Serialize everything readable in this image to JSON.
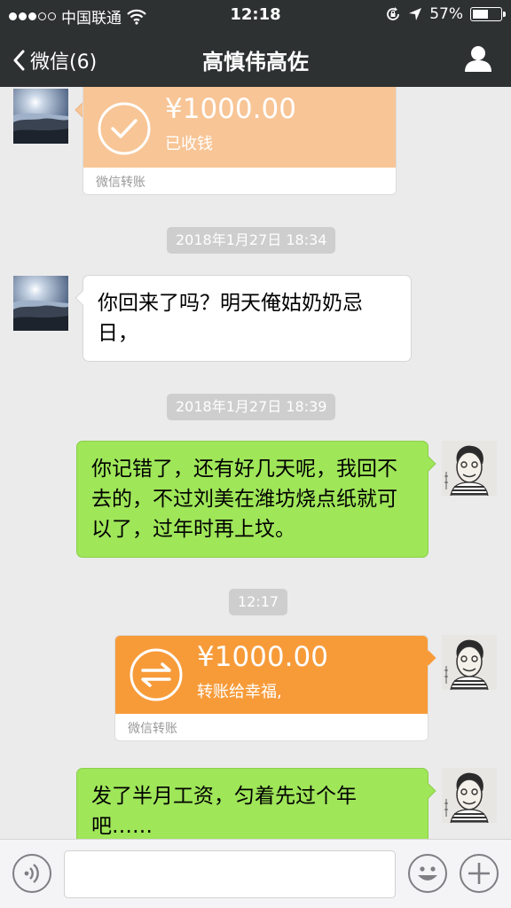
{
  "status_bar": {
    "carrier": "中国联通",
    "time": "12:18",
    "battery_percent": "57%",
    "battery_level": 0.57,
    "icons": [
      "signal-dots-icon",
      "wifi-icon",
      "rotation-lock-icon",
      "location-arrow-icon",
      "battery-icon"
    ]
  },
  "nav": {
    "back_label": "微信(6)",
    "title": "高慎伟高佐",
    "icons": [
      "chevron-left-icon",
      "person-icon"
    ]
  },
  "messages": {
    "transfer_received": {
      "amount": "¥1000.00",
      "note": "已收钱",
      "footer": "微信转账",
      "color": "#f8c596",
      "icon": "check-circle-icon"
    },
    "timestamp_1": "2018年1月27日 18:34",
    "left_text": "你回来了吗？明天俺姑奶奶忌日，",
    "timestamp_2": "2018年1月27日 18:39",
    "right_text_1": "你记错了，还有好几天呢，我回不去的，不过刘美在潍坊烧点纸就可以了，过年时再上坟。",
    "timestamp_3": "12:17",
    "transfer_sent": {
      "amount": "¥1000.00",
      "note": "转账给幸福,",
      "footer": "微信转账",
      "color": "#f79b39",
      "icon": "transfer-arrows-icon"
    },
    "right_text_2": "发了半月工资，匀着先过个年吧……"
  },
  "input_bar": {
    "placeholder": "",
    "icons": [
      "voice-icon",
      "emoji-icon",
      "plus-icon"
    ]
  },
  "colors": {
    "header_bg": "#2e3132",
    "chat_bg": "#ebebeb",
    "bubble_green": "#9fe659",
    "timestamp_bg": "#cecece"
  }
}
